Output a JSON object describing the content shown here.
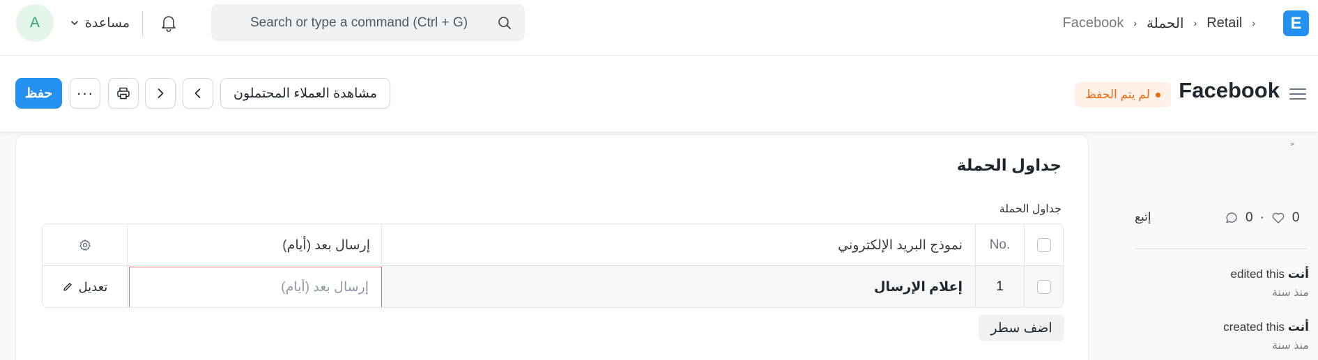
{
  "navbar": {
    "avatar_initial": "A",
    "help_label": "مساعدة",
    "search_placeholder": "Search or type a command (Ctrl + G)",
    "breadcrumbs": [
      "Retail",
      "الحملة",
      "Facebook"
    ],
    "logo_letter": "E"
  },
  "page_head": {
    "title": "Facebook",
    "status": "لم يتم الحفظ",
    "save_label": "حفظ",
    "more_label": "···",
    "view_leads_label": "مشاهدة العملاء المحتملون"
  },
  "sidebar": {
    "tick": "ٍ",
    "likes_count": "0",
    "comments_count": "0",
    "follow_label": "إتبع",
    "activity": [
      {
        "actor": "أنت",
        "action": "edited this",
        "when": "منذ سنة"
      },
      {
        "actor": "أنت",
        "action": "created this",
        "when": "منذ سنة"
      }
    ]
  },
  "section": {
    "title": "جداول الحملة",
    "field_label": "جداول الحملة",
    "columns": {
      "no": "No.",
      "email_template": "نموذج البريد الإلكتروني",
      "send_after": "إرسال بعد (أيام)"
    },
    "rows": [
      {
        "no": "1",
        "email_template": "إعلام الإرسال",
        "send_after_placeholder": "إرسال بعد (أيام)",
        "edit_label": "تعديل"
      }
    ],
    "add_row_label": "اضف سطر"
  },
  "colors": {
    "primary": "#2490ef",
    "status_text": "#e86c13",
    "status_bg": "#fff1e7",
    "avatar_bg": "#e4f5e9",
    "avatar_text": "#30a66d",
    "invalid_border": "#e26b6b"
  }
}
